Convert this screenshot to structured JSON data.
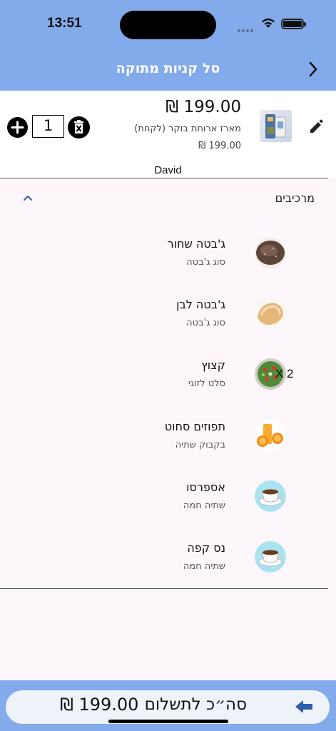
{
  "status_bar": {
    "time": "13:51"
  },
  "header": {
    "title": "סל קניות מתוקה"
  },
  "cart_item": {
    "price": "199.00 ₪",
    "name": "מארז ארוחת בוקר (לקחת)",
    "unit_price": "199.00 ₪",
    "quantity": "1",
    "customer": "David"
  },
  "components": {
    "title": "מרכיבים",
    "items": [
      {
        "name": "ג'בטה שחור",
        "category": "סוג ג'בטה",
        "qty": ""
      },
      {
        "name": "ג'בטה לבן",
        "category": "סוג ג'בטה",
        "qty": ""
      },
      {
        "name": "קצוץ",
        "category": "סלט לזוגי",
        "qty": "X 2"
      },
      {
        "name": "תפוזים סחוט",
        "category": "בקבוק שתיה",
        "qty": ""
      },
      {
        "name": "אספרסו",
        "category": "שתיה חמה",
        "qty": ""
      },
      {
        "name": "נס קפה",
        "category": "שתיה חמה",
        "qty": ""
      }
    ]
  },
  "footer": {
    "pay_label": "סה״כ לתשלום",
    "total": "199.00 ₪"
  },
  "colors": {
    "accent": "#83aaeb",
    "background": "#fdf6fb"
  },
  "icons": [
    "back-chevron-icon",
    "edit-icon",
    "plus-circle-icon",
    "delete-icon",
    "chevron-up-icon",
    "arrow-left-icon"
  ]
}
